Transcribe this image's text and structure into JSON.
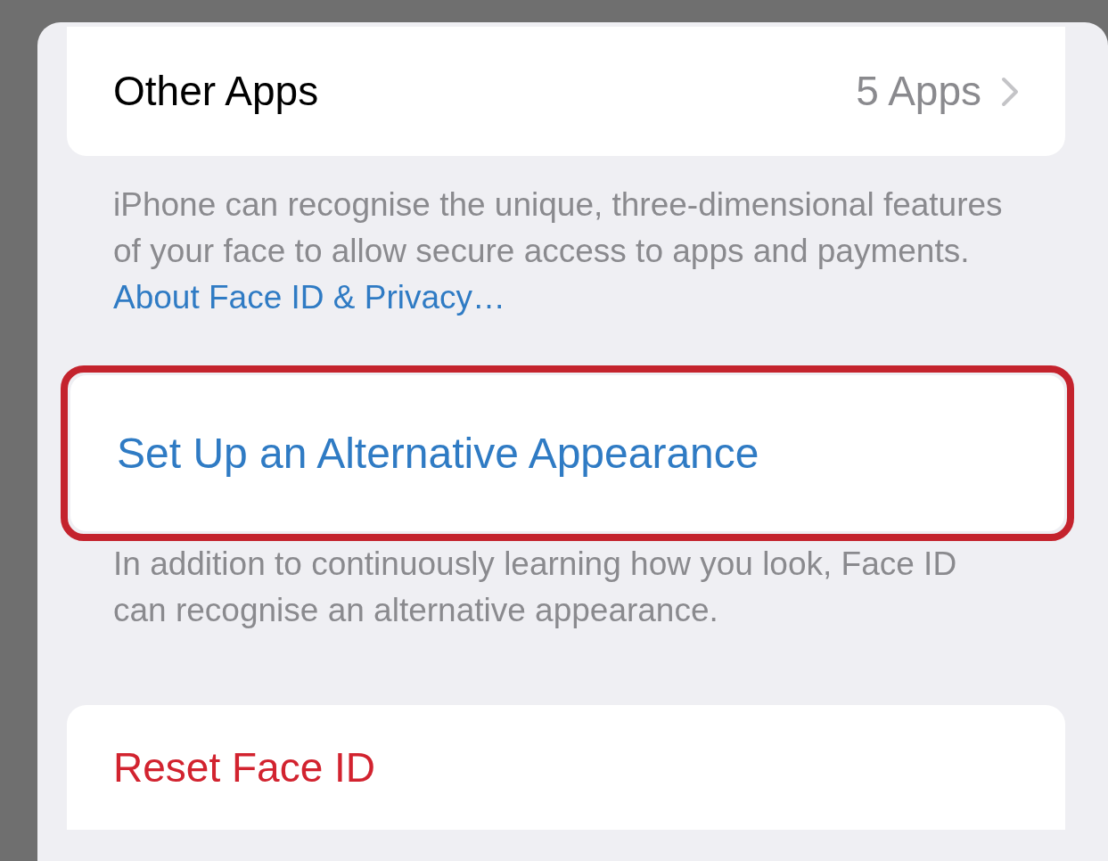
{
  "other_apps": {
    "label": "Other Apps",
    "value": "5 Apps"
  },
  "face_id_footer": {
    "text": "iPhone can recognise the unique, three-dimensional features of your face to allow secure access to apps and payments.",
    "link": "About Face ID & Privacy…"
  },
  "alternative_appearance": {
    "label": "Set Up an Alternative Appearance"
  },
  "alternative_footer": "In addition to continuously learning how you look, Face ID can recognise an alternative appearance.",
  "reset": {
    "label": "Reset Face ID"
  }
}
